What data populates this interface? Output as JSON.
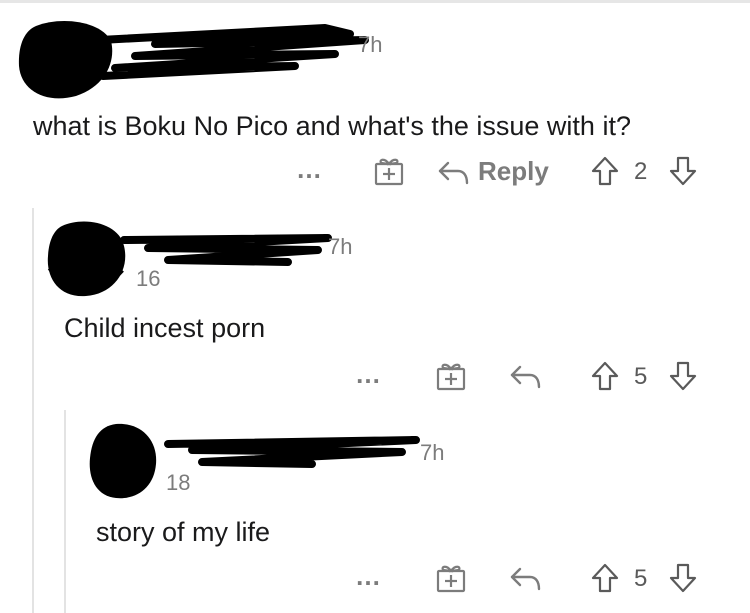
{
  "comments": [
    {
      "time": "7h",
      "karma": "",
      "body": "what is Boku No Pico and what's the issue with it?",
      "actions": {
        "more": "…",
        "award_icon": "gift-icon",
        "reply_icon": "reply-arrow-icon",
        "reply_label": "Reply",
        "upvote_icon": "arrow-up-icon",
        "score": "2",
        "downvote_icon": "arrow-down-icon"
      }
    },
    {
      "time": "7h",
      "karma": "16",
      "body": "Child incest porn",
      "actions": {
        "more": "…",
        "award_icon": "gift-icon",
        "reply_icon": "reply-arrow-icon",
        "upvote_icon": "arrow-up-icon",
        "score": "5",
        "downvote_icon": "arrow-down-icon"
      }
    },
    {
      "time": "7h",
      "karma": "18",
      "body": "story of my life",
      "actions": {
        "more": "…",
        "award_icon": "gift-icon",
        "reply_icon": "reply-arrow-icon",
        "upvote_icon": "arrow-up-icon",
        "score": "5",
        "downvote_icon": "arrow-down-icon"
      }
    }
  ],
  "colors": {
    "text": "#1a1a1b",
    "meta": "#7c7c7c",
    "thread_line": "#e3e3e3",
    "redaction": "#000000"
  }
}
